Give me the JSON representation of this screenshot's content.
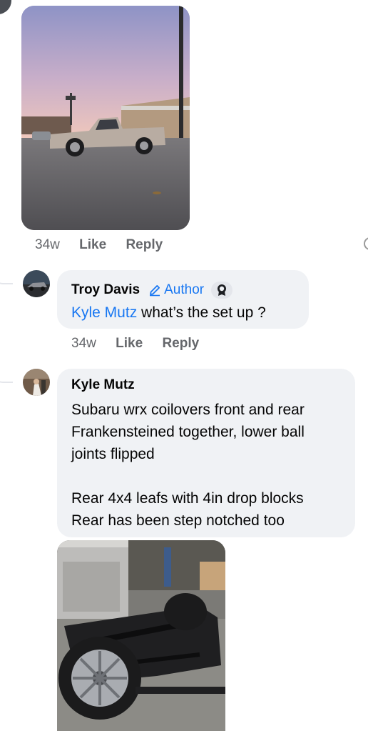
{
  "comment1": {
    "time": "34w",
    "like_label": "Like",
    "reply_label": "Reply"
  },
  "comment2": {
    "author_name": "Troy Davis",
    "author_badge": "Author",
    "mention": "Kyle Mutz",
    "text": " what’s the set up ?",
    "time": "34w",
    "like_label": "Like",
    "reply_label": "Reply"
  },
  "comment3": {
    "author_name": "Kyle Mutz",
    "lines": [
      "Subaru wrx coilovers front and rear",
      "Frankensteined together, lower ball",
      "joints flipped",
      "",
      "Rear 4x4 leafs with 4in drop blocks",
      "Rear has been step notched too"
    ]
  },
  "colors": {
    "link": "#1877f2",
    "bubble": "#f0f2f5",
    "meta": "#65676b"
  },
  "icons": {
    "author": "pencil-icon",
    "top_fan": "badge-icon"
  }
}
